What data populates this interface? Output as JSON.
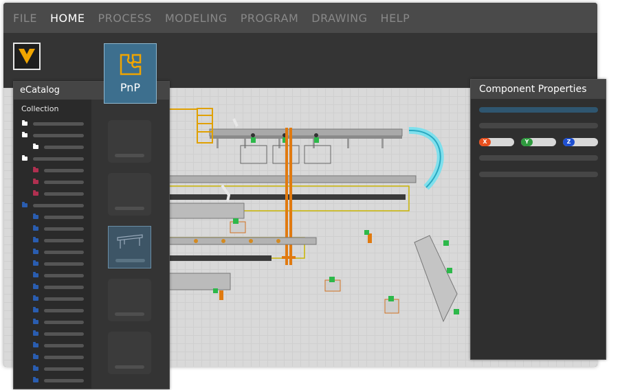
{
  "menu": {
    "items": [
      {
        "label": "FILE",
        "active": false
      },
      {
        "label": "HOME",
        "active": true
      },
      {
        "label": "PROCESS",
        "active": false
      },
      {
        "label": "MODELING",
        "active": false
      },
      {
        "label": "PROGRAM",
        "active": false
      },
      {
        "label": "DRAWING",
        "active": false
      },
      {
        "label": "HELP",
        "active": false
      }
    ]
  },
  "ribbon": {
    "pnp_label": "PnP",
    "pnp_icon": "puzzle-piece-icon",
    "logo_icon": "v-logo-icon"
  },
  "catalog": {
    "title": "eCatalog",
    "collection_label": "Collection"
  },
  "properties": {
    "title": "Component Properties",
    "axes": [
      {
        "label": "X",
        "color": "#e8501e"
      },
      {
        "label": "Y",
        "color": "#2e9a3e"
      },
      {
        "label": "Z",
        "color": "#1e4fd0"
      }
    ]
  },
  "colors": {
    "accent": "#3d6f8e",
    "folder_white": "#ffffff",
    "folder_red": "#b03050",
    "folder_blue": "#2a5db0"
  }
}
